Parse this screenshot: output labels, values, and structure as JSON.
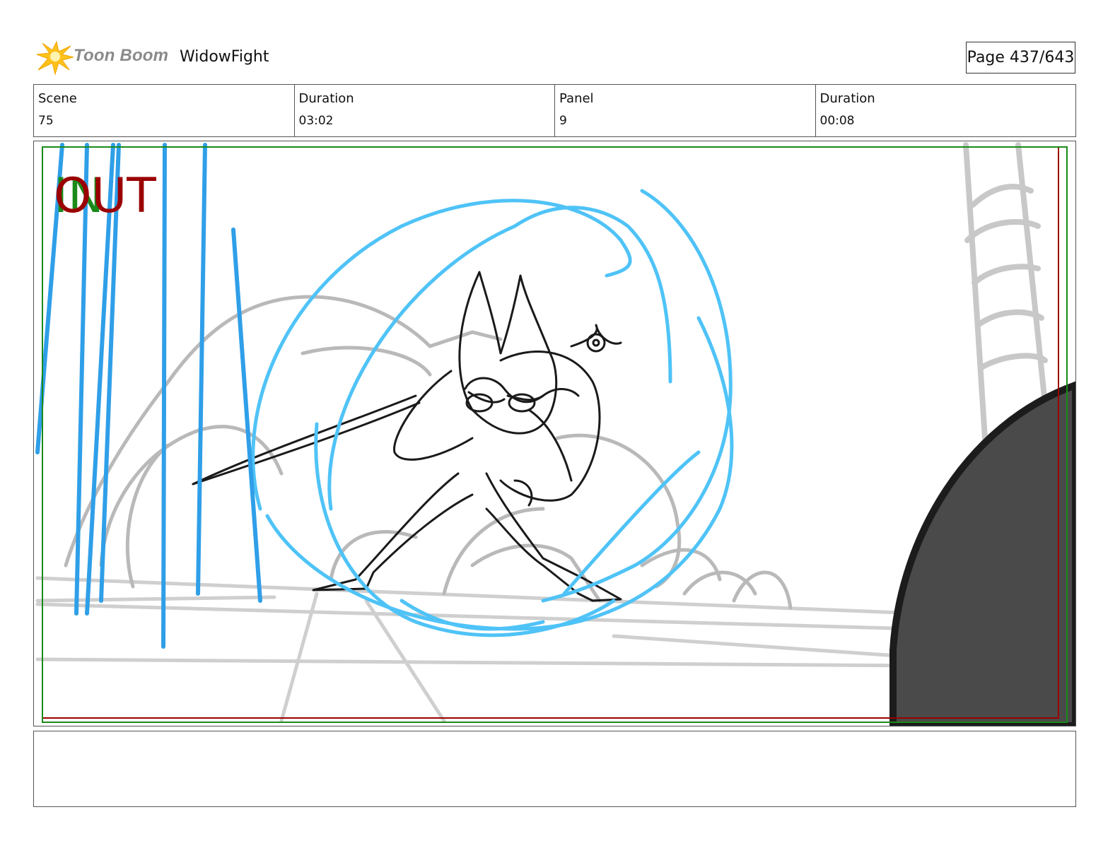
{
  "header": {
    "logo_text": "Toon Boom",
    "project_title": "WidowFight",
    "page_indicator": "Page 437/643"
  },
  "info": {
    "scene_label": "Scene",
    "scene_value": "75",
    "scene_duration_label": "Duration",
    "scene_duration_value": "03:02",
    "panel_label": "Panel",
    "panel_value": "9",
    "panel_duration_label": "Duration",
    "panel_duration_value": "00:08"
  },
  "panel": {
    "in_marker": "IN",
    "out_marker": "OUT"
  },
  "notes": {
    "text": ""
  },
  "colors": {
    "sketch_blue": "#4fc3f7",
    "rain_blue": "#2f9fe8",
    "frame_red": "#9b0000",
    "frame_green": "#1a8a1a",
    "background_grey": "#bdbdbd",
    "foreground_dark": "#4a4a4a"
  }
}
